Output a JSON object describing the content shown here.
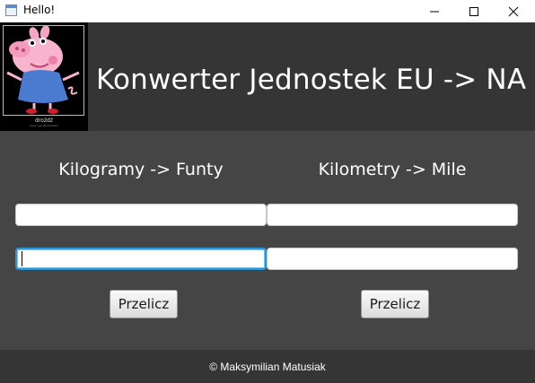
{
  "window": {
    "title": "Hello!",
    "icon": "java-app-icon",
    "controls": [
      "minimize-icon",
      "maximize-icon",
      "close-icon"
    ]
  },
  "header": {
    "title": "Konwerter Jednostek EU -> NA",
    "logo": {
      "depicts": "peppa-pig-image",
      "caption": "drożdż",
      "subcaption": "super cool demotivation"
    }
  },
  "converters": {
    "mass": {
      "label": "Kilogramy -> Funty",
      "input_value": "",
      "output_value": "",
      "button_label": "Przelicz"
    },
    "distance": {
      "label": "Kilometry -> Mile",
      "input_value": "",
      "output_value": "",
      "button_label": "Przelicz"
    }
  },
  "footer": {
    "text": "© Maksymilian Matusiak"
  },
  "colors": {
    "header_bg": "#353535",
    "main_bg": "#454545",
    "footer_bg": "#353535",
    "focus_accent": "#2a95d6"
  }
}
